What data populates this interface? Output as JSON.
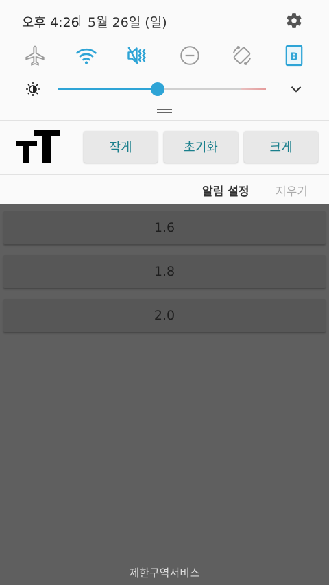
{
  "status": {
    "time": "오후 4:26",
    "date": "5월 26일 (일)"
  },
  "quick_toggles": [
    {
      "icon": "airplane-mode-icon",
      "active": false
    },
    {
      "icon": "wifi-icon",
      "active": true
    },
    {
      "icon": "sound-mute-vibrate-icon",
      "active": true
    },
    {
      "icon": "do-not-disturb-icon",
      "active": false
    },
    {
      "icon": "auto-rotate-icon",
      "active": false
    },
    {
      "icon": "bluetooth-b-icon",
      "active": true
    }
  ],
  "brightness": {
    "level": 0.48
  },
  "font_size": {
    "small_label": "작게",
    "reset_label": "초기화",
    "large_label": "크게"
  },
  "notification_actions": {
    "settings_label": "알림 설정",
    "clear_label": "지우기"
  },
  "list": [
    "1.6",
    "1.8",
    "2.0"
  ],
  "carrier": "제한구역서비스",
  "colors": {
    "accent": "#2ea4d6",
    "button_text": "#1a7f8c",
    "panel_bg": "#fafafa",
    "backdrop": "#5f5f5f"
  }
}
